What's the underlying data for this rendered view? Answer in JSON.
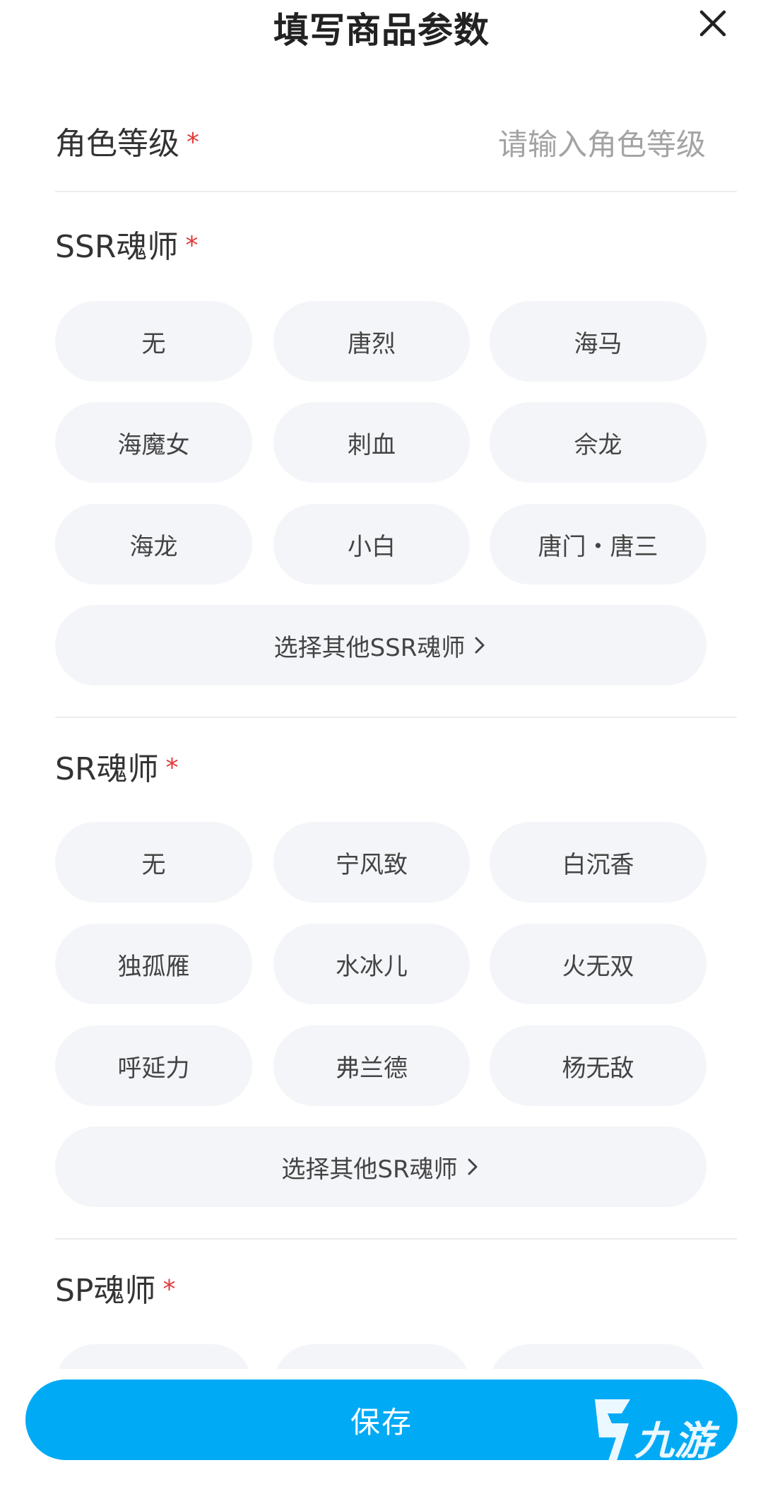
{
  "header": {
    "title": "填写商品参数",
    "close_icon": "close-icon"
  },
  "level": {
    "label": "角色等级",
    "required": "*",
    "placeholder": "请输入角色等级",
    "value": ""
  },
  "ssr": {
    "title": "SSR魂师",
    "required": "*",
    "options": [
      "无",
      "唐烈",
      "海马",
      "海魔女",
      "刺血",
      "佘龙",
      "海龙",
      "小白",
      "唐门・唐三"
    ],
    "more": "选择其他SSR魂师"
  },
  "sr": {
    "title": "SR魂师",
    "required": "*",
    "options": [
      "无",
      "宁风致",
      "白沉香",
      "独孤雁",
      "水冰儿",
      "火无双",
      "呼延力",
      "弗兰德",
      "杨无敌"
    ],
    "more": "选择其他SR魂师"
  },
  "sp": {
    "title": "SP魂师",
    "required": "*"
  },
  "footer": {
    "save": "保存"
  },
  "watermark": {
    "text": "九游"
  },
  "colors": {
    "accent": "#00aaf5",
    "required": "#e03b3b",
    "chip_bg": "#f4f5f8"
  }
}
